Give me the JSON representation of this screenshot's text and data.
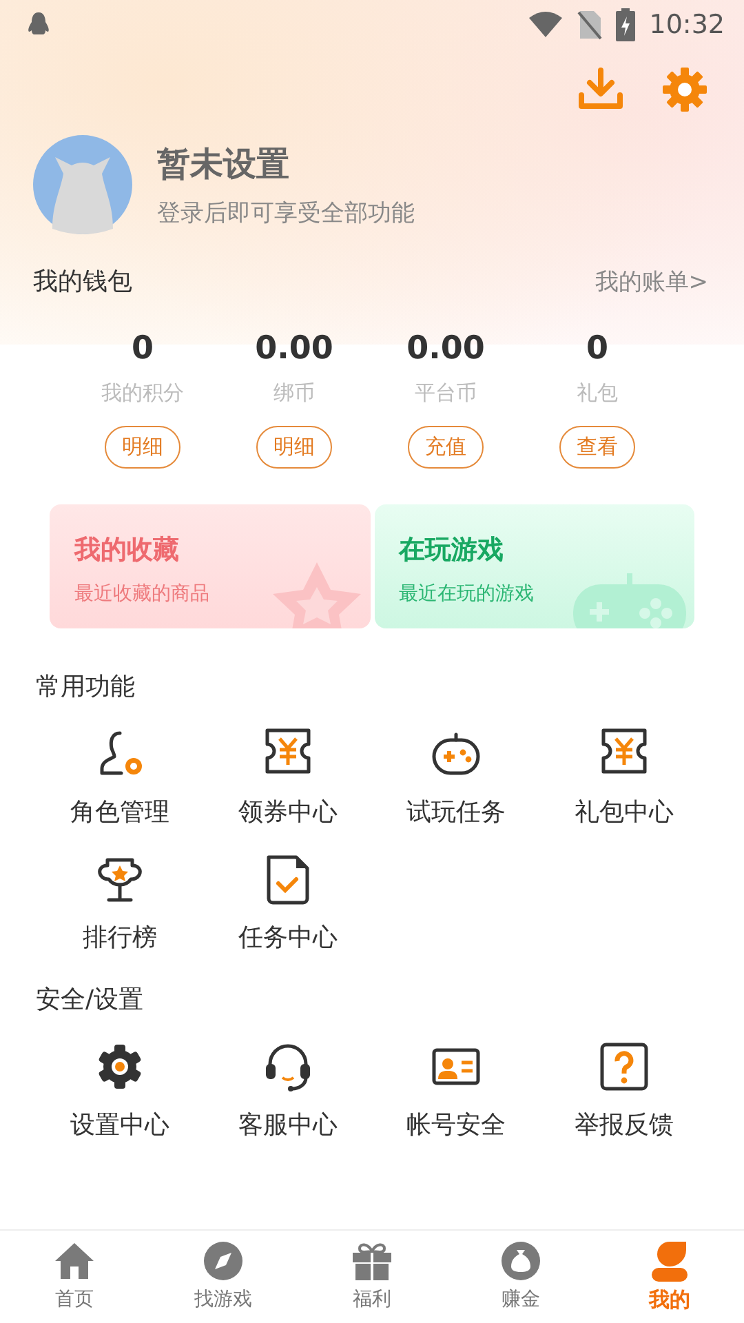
{
  "status_bar": {
    "time": "10:32"
  },
  "profile": {
    "name": "暂未设置",
    "subtitle": "登录后即可享受全部功能"
  },
  "wallet": {
    "title": "我的钱包",
    "link": "我的账单>",
    "items": [
      {
        "value": "0",
        "label": "我的积分",
        "action": "明细"
      },
      {
        "value": "0.00",
        "label": "绑币",
        "action": "明细"
      },
      {
        "value": "0.00",
        "label": "平台币",
        "action": "充值"
      },
      {
        "value": "0",
        "label": "礼包",
        "action": "查看"
      }
    ]
  },
  "cards": [
    {
      "kind": "favorites",
      "title": "我的收藏",
      "subtitle": "最近收藏的商品"
    },
    {
      "kind": "playing",
      "title": "在玩游戏",
      "subtitle": "最近在玩的游戏"
    }
  ],
  "sections": [
    {
      "title": "常用功能",
      "items": [
        {
          "label": "角色管理"
        },
        {
          "label": "领券中心"
        },
        {
          "label": "试玩任务"
        },
        {
          "label": "礼包中心"
        },
        {
          "label": "排行榜"
        },
        {
          "label": "任务中心"
        }
      ]
    },
    {
      "title": "安全/设置",
      "items": [
        {
          "label": "设置中心"
        },
        {
          "label": "客服中心"
        },
        {
          "label": "帐号安全"
        },
        {
          "label": "举报反馈"
        }
      ]
    }
  ],
  "bottom_nav": [
    {
      "label": "首页",
      "selected": false
    },
    {
      "label": "找游戏",
      "selected": false
    },
    {
      "label": "福利",
      "selected": false
    },
    {
      "label": "赚金",
      "selected": false
    },
    {
      "label": "我的",
      "selected": true
    }
  ]
}
